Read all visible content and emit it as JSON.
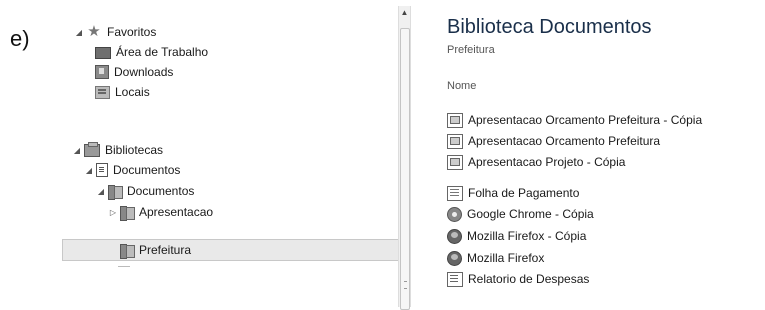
{
  "question_label": "e)",
  "nav": {
    "favorites": {
      "label": "Favoritos",
      "items": [
        {
          "label": "Área de Trabalho",
          "icon": "desktop-icon"
        },
        {
          "label": "Downloads",
          "icon": "downloads-icon"
        },
        {
          "label": "Locais",
          "icon": "recent-places-icon"
        }
      ]
    },
    "libraries": {
      "label": "Bibliotecas",
      "documents_library": "Documentos",
      "documents_folder": "Documentos",
      "subfolders": [
        {
          "label": "Apresentacao",
          "expandable": true
        },
        {
          "label": "Prefeitura",
          "selected": true
        }
      ]
    }
  },
  "content": {
    "title": "Biblioteca Documentos",
    "subtitle": "Prefeitura",
    "column_header": "Nome",
    "files": [
      {
        "name": "Apresentacao Orcamento Prefeitura - Cópia",
        "icon": "presentation-file-icon"
      },
      {
        "name": "Apresentacao Orcamento Prefeitura",
        "icon": "presentation-file-icon"
      },
      {
        "name": "Apresentacao Projeto - Cópia",
        "icon": "presentation-file-icon"
      },
      {
        "name": "Folha de Pagamento",
        "icon": "spreadsheet-file-icon"
      },
      {
        "name": "Google Chrome - Cópia",
        "icon": "chrome-shortcut-icon"
      },
      {
        "name": "Mozilla Firefox - Cópia",
        "icon": "firefox-shortcut-icon"
      },
      {
        "name": "Mozilla Firefox",
        "icon": "firefox-shortcut-icon"
      },
      {
        "name": "Relatorio de Despesas",
        "icon": "document-file-icon"
      }
    ]
  }
}
